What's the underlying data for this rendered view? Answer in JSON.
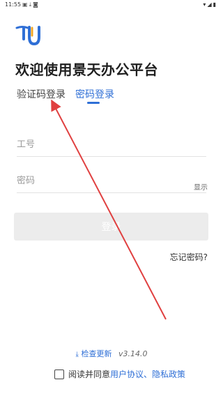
{
  "status_bar": {
    "time": "11:55",
    "left_icons": [
      "image-icon",
      "download-icon",
      "app-icon"
    ],
    "right_icons": [
      "wifi-icon",
      "signal-icon",
      "battery-icon"
    ]
  },
  "app": {
    "title": "欢迎使用景天办公平台",
    "brand_color": "#2f6fd6",
    "logo_colors": [
      "#2f6fd6",
      "#f6a623"
    ]
  },
  "tabs": [
    {
      "label": "验证码登录",
      "active": false
    },
    {
      "label": "密码登录",
      "active": true
    }
  ],
  "form": {
    "id_placeholder": "工号",
    "id_value": "",
    "password_placeholder": "密码",
    "password_value": "",
    "show_label": "显示"
  },
  "login_button": {
    "label": "登录",
    "enabled": false
  },
  "forgot_password": "忘记密码?",
  "update": {
    "icon": "download-icon",
    "label": "检查更新",
    "version": "v3.14.0"
  },
  "agreement": {
    "prefix": "阅读并同意",
    "user_agreement": "用户协议",
    "separator": "、",
    "privacy_policy": "隐私政策",
    "checked": false
  },
  "annotation": {
    "type": "red-arrow",
    "color": "#e04040",
    "points_to": "验证码登录"
  }
}
